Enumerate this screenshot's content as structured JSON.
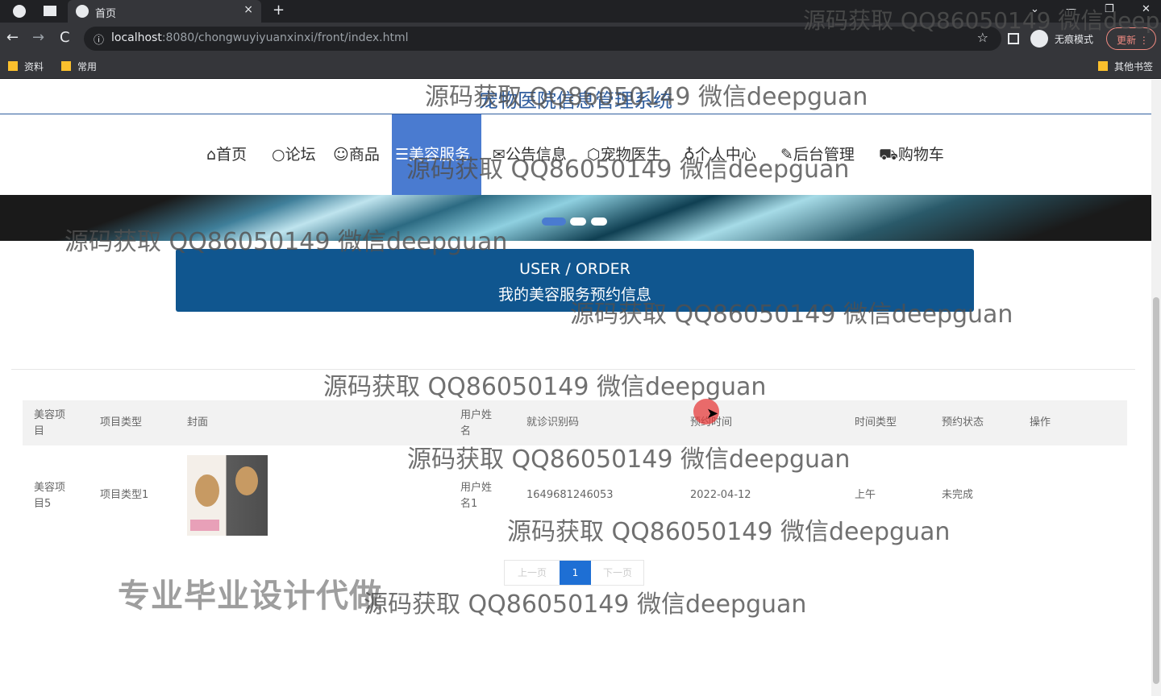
{
  "browser": {
    "tab_title": "首页",
    "tab_close": "×",
    "new_tab": "+",
    "url_host": "localhost",
    "url_rest": ":8080/chongwuyiyuanxinxi/front/index.html",
    "incognito_label": "无痕模式",
    "update_label": "更新",
    "bookmarks": [
      "资料",
      "常用"
    ],
    "other_bookmarks": "其他书签",
    "controls": {
      "back": "←",
      "forward": "→",
      "reload": "C",
      "star": "☆",
      "minimize": "—",
      "restore": "❐",
      "close": "✕",
      "menu": "⋮",
      "info": "ⓘ",
      "chevron": "⌄"
    }
  },
  "site": {
    "title": "宠物医院信息管理系统",
    "nav": [
      {
        "icon": "⌂",
        "label": "首页"
      },
      {
        "icon": "○",
        "label": "论坛"
      },
      {
        "icon": "☺",
        "label": "商品"
      },
      {
        "icon": "☰",
        "label": "美容服务"
      },
      {
        "icon": "✉",
        "label": "公告信息"
      },
      {
        "icon": "⬡",
        "label": "宠物医生"
      },
      {
        "icon": "♁",
        "label": "个人中心"
      },
      {
        "icon": "✎",
        "label": "后台管理"
      },
      {
        "icon": "⛟",
        "label": "购物车"
      }
    ],
    "active_nav": "美容服务"
  },
  "order_section": {
    "title_en": "USER / ORDER",
    "title_cn": "我的美容服务预约信息"
  },
  "table": {
    "headers": [
      "美容项目",
      "项目类型",
      "封面",
      "用户姓名",
      "就诊识别码",
      "预约时间",
      "时间类型",
      "预约状态",
      "操作"
    ],
    "rows": [
      {
        "item": "美容项目5",
        "type": "项目类型1",
        "cover": "dog-photo",
        "user": "用户姓名1",
        "code": "1649681246053",
        "time": "2022-04-12",
        "time_type": "上午",
        "status": "未完成",
        "action": ""
      }
    ]
  },
  "pagination": {
    "prev": "上一页",
    "current": "1",
    "next": "下一页"
  },
  "promo_text": "专业毕业设计代做",
  "watermark": "源码获取 QQ86050149 微信deepguan",
  "colors": {
    "nav_active": "#4a7bd0",
    "order_header": "#10568f",
    "page_active": "#1e6fd4",
    "title": "#2f5d9e"
  }
}
